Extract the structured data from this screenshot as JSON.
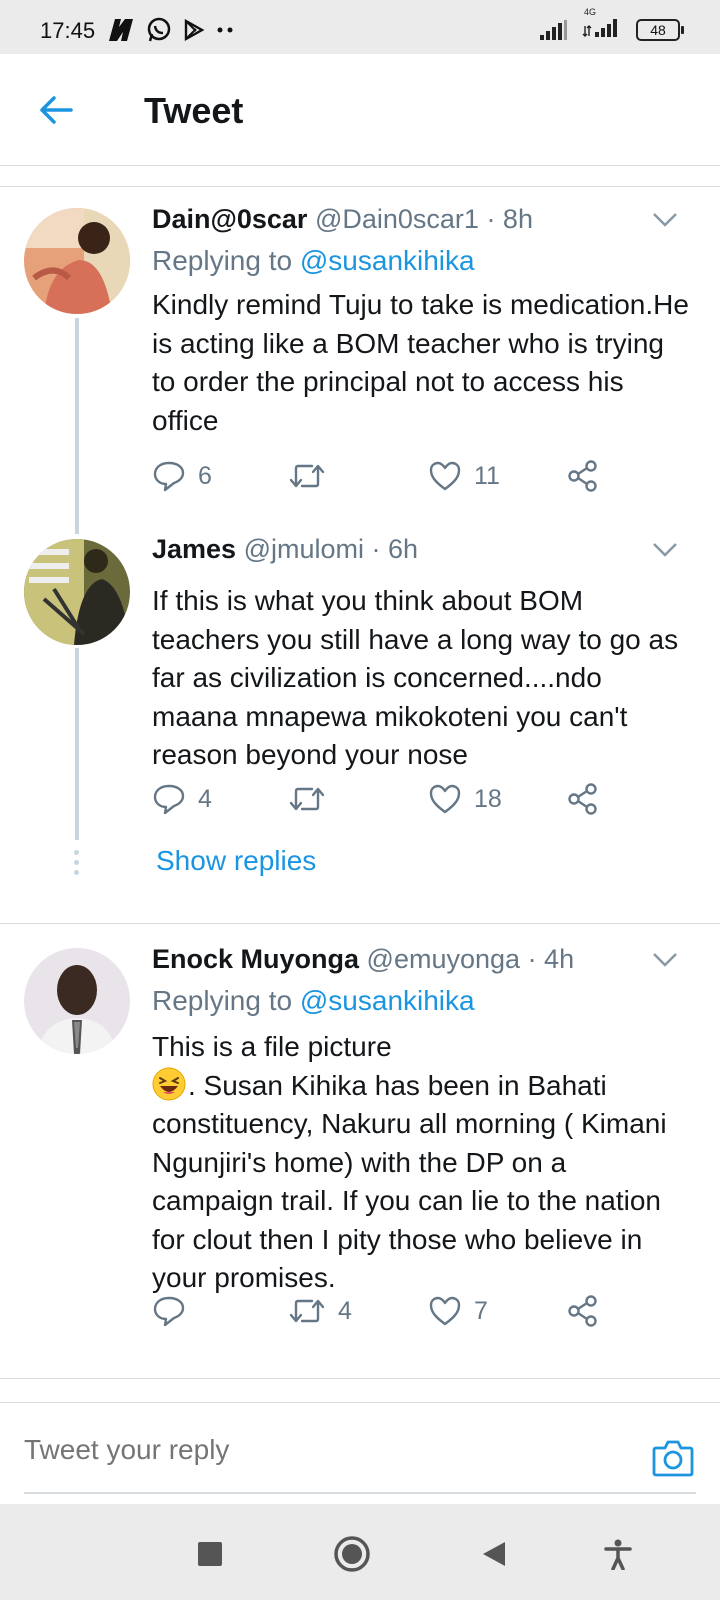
{
  "status_bar": {
    "time": "17:45",
    "network_label": "4G",
    "battery": "48"
  },
  "header": {
    "title": "Tweet"
  },
  "tweets": [
    {
      "name": "Dain@0scar",
      "handle": "@Dain0scar1",
      "time": "· 8h",
      "replying_prefix": "Replying to",
      "replying_to": "@susankihika",
      "text": "Kindly remind Tuju to take is medication.He is acting like a BOM teacher who is trying to order the principal not to access his office",
      "reply_count": "6",
      "retweet_count": "",
      "like_count": "11"
    },
    {
      "name": "James",
      "handle": "@jmulomi",
      "time": "· 6h",
      "text": "If this is what you think about BOM teachers you still have a long way to go as far as civilization is concerned....ndo maana mnapewa mikokoteni you can't reason beyond your nose",
      "reply_count": "4",
      "retweet_count": "",
      "like_count": "18",
      "show_replies": "Show replies"
    },
    {
      "name": "Enock Muyonga",
      "handle": "@emuyonga",
      "time": "· 4h",
      "replying_prefix": "Replying to",
      "replying_to": "@susankihika",
      "text_line1": "This is a file picture",
      "text_rest": ". Susan Kihika has been in Bahati constituency, Nakuru all morning ( Kimani Ngunjiri's home) with the DP on a campaign trail. If you can lie to the nation for clout then I pity those who believe in your promises.",
      "emoji": "laughing-face",
      "reply_count": "",
      "retweet_count": "4",
      "like_count": "7"
    }
  ],
  "reply_bar": {
    "placeholder": "Tweet your reply"
  },
  "colors": {
    "accent": "#1b95e0",
    "secondary_text": "#657786",
    "divider": "#d8dde1",
    "system_bar": "#ebebeb"
  }
}
